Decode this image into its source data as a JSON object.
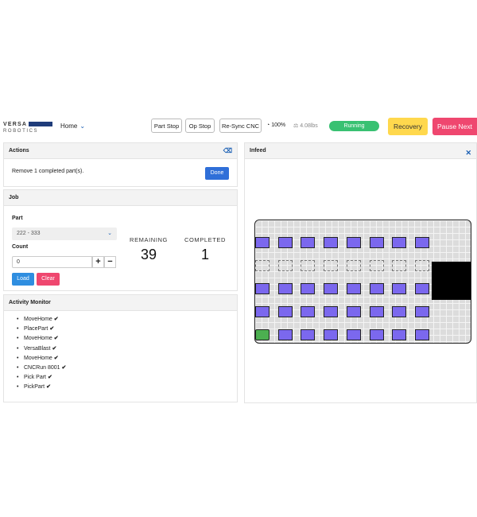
{
  "header": {
    "logo_top": "VERSA",
    "logo_bottom": "ROBOTICS",
    "home_label": "Home",
    "part_stop": "Part Stop",
    "op_stop": "Op Stop",
    "resync": "Re-Sync CNC",
    "speed": "100%",
    "weight": "4.08lbs",
    "status": "Running",
    "recovery": "Recovery",
    "pause_next": "Pause Next",
    "colors": {
      "running": "#38c172",
      "recovery": "#ffd84d",
      "pause": "#ef476f"
    }
  },
  "actions": {
    "title": "Actions",
    "message": "Remove 1 completed part(s).",
    "done_label": "Done"
  },
  "job": {
    "title": "Job",
    "part_label": "Part",
    "part_value": "222 - 333",
    "count_label": "Count",
    "count_value": "0",
    "plus": "+",
    "minus": "−",
    "load_label": "Load",
    "clear_label": "Clear",
    "remaining_label": "REMAINING",
    "remaining_value": "39",
    "completed_label": "COMPLETED",
    "completed_value": "1"
  },
  "activity": {
    "title": "Activity Monitor",
    "items": [
      "MoveHome",
      "PlacePart",
      "MoveHome",
      "VersaBlast",
      "MoveHome",
      "CNCRun 8001",
      "Pick Part",
      "PickPart"
    ]
  },
  "infeed": {
    "title": "Infeed",
    "rows": [
      [
        "filled",
        "filled",
        "filled",
        "filled",
        "filled",
        "filled",
        "filled",
        "filled"
      ],
      [
        "empty",
        "empty",
        "empty",
        "empty",
        "empty",
        "empty",
        "empty",
        "empty"
      ],
      [
        "filled",
        "filled",
        "filled",
        "filled",
        "filled",
        "filled",
        "filled",
        "filled"
      ],
      [
        "filled",
        "filled",
        "filled",
        "filled",
        "filled",
        "filled",
        "filled",
        "filled"
      ],
      [
        "done",
        "filled",
        "filled",
        "filled",
        "filled",
        "filled",
        "filled",
        "filled"
      ]
    ],
    "colors": {
      "filled": "#7b68ee",
      "done": "#4caf50"
    }
  }
}
